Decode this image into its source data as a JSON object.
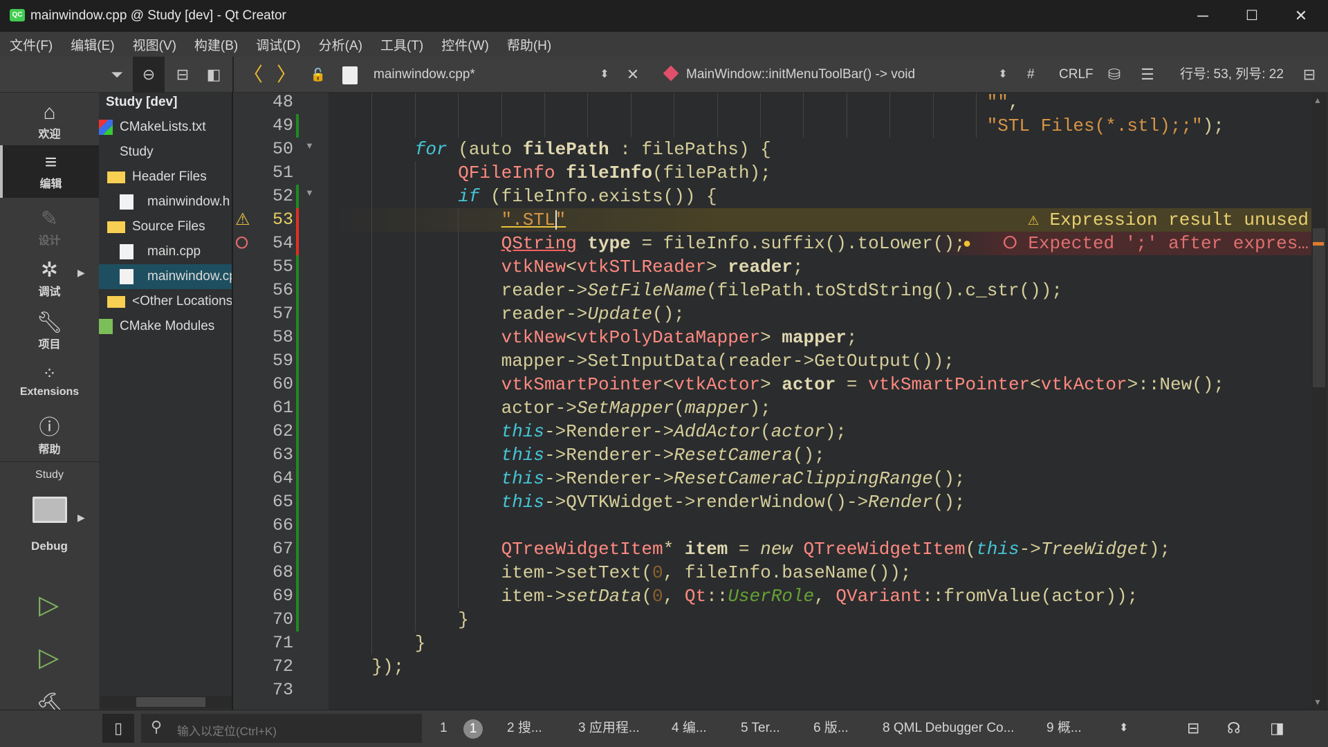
{
  "window": {
    "title": "mainwindow.cpp @ Study [dev] - Qt Creator",
    "app_icon": "QC",
    "minimize": "─",
    "maximize": "☐",
    "close": "✕"
  },
  "menu": [
    "文件(F)",
    "编辑(E)",
    "视图(V)",
    "构建(B)",
    "调试(D)",
    "分析(A)",
    "工具(T)",
    "控件(W)",
    "帮助(H)"
  ],
  "editor_toolbar": {
    "file_name": "mainwindow.cpp*",
    "function": "MainWindow::initMenuToolBar() -> void",
    "hash": "#",
    "line_ending": "CRLF",
    "position": "行号: 53, 列号: 22"
  },
  "modes": [
    {
      "label": "欢迎",
      "icon": "home-icon"
    },
    {
      "label": "编辑",
      "icon": "edit-icon",
      "selected": true
    },
    {
      "label": "设计",
      "icon": "design-icon",
      "disabled": true
    },
    {
      "label": "调试",
      "icon": "debug-icon"
    },
    {
      "label": "项目",
      "icon": "wrench-icon"
    },
    {
      "label": "Extensions",
      "icon": "extensions-icon"
    },
    {
      "label": "帮助",
      "icon": "help-icon"
    }
  ],
  "kit": {
    "project": "Study",
    "config": "Debug"
  },
  "tree": [
    {
      "label": "Study [dev]",
      "level": 0,
      "icon": "none",
      "bold": true
    },
    {
      "label": "CMakeLists.txt",
      "level": 0,
      "icon": "cmake-icon"
    },
    {
      "label": "Study",
      "level": 0,
      "icon": "hammer-icon"
    },
    {
      "label": "Header Files",
      "level": 1,
      "icon": "folder-icon"
    },
    {
      "label": "mainwindow.h",
      "level": 2,
      "icon": "header-file-icon"
    },
    {
      "label": "Source Files",
      "level": 1,
      "icon": "folder-icon"
    },
    {
      "label": "main.cpp",
      "level": 2,
      "icon": "cpp-file-icon"
    },
    {
      "label": "mainwindow.cpp",
      "level": 2,
      "icon": "cpp-file-icon",
      "selected": true
    },
    {
      "label": "<Other Locations>",
      "level": 1,
      "icon": "folder-icon"
    },
    {
      "label": "CMake Modules",
      "level": 0,
      "icon": "modules-icon"
    }
  ],
  "code": {
    "first_line": 48,
    "cursor": {
      "line": 53,
      "column": 22
    },
    "lines": [
      {
        "n": 48,
        "indent": 61,
        "tokens": [
          [
            "\"\"",
            "str"
          ],
          [
            ",",
            "p"
          ]
        ]
      },
      {
        "n": 49,
        "indent": 61,
        "tokens": [
          [
            "\"STL Files(*.stl);;\"",
            "str"
          ],
          [
            ");",
            "p"
          ]
        ]
      },
      {
        "n": 50,
        "indent": 8,
        "fold": true,
        "tokens": [
          [
            "for",
            "kw"
          ],
          [
            " (auto ",
            "p"
          ],
          [
            "filePath",
            "b"
          ],
          [
            " : filePaths) {",
            "p"
          ]
        ]
      },
      {
        "n": 51,
        "indent": 12,
        "tokens": [
          [
            "QFileInfo",
            "t"
          ],
          [
            " ",
            "p"
          ],
          [
            "fileInfo",
            "b"
          ],
          [
            "(filePath);",
            "p"
          ]
        ]
      },
      {
        "n": 52,
        "indent": 12,
        "fold": true,
        "tokens": [
          [
            "if",
            "kw"
          ],
          [
            " (fileInfo.exists()) {",
            "p"
          ]
        ]
      },
      {
        "n": 53,
        "indent": 16,
        "marker": "warning",
        "tokens": [
          [
            "\".STL\"",
            "str warnu"
          ]
        ]
      },
      {
        "n": 54,
        "indent": 16,
        "marker": "error",
        "tokens": [
          [
            "QString",
            "t erru"
          ],
          [
            " ",
            "p"
          ],
          [
            "type",
            "b"
          ],
          [
            " = fileInfo.suffix().toLower();",
            "p"
          ]
        ]
      },
      {
        "n": 55,
        "indent": 16,
        "tokens": [
          [
            "vtkNew",
            "t"
          ],
          [
            "<",
            "p"
          ],
          [
            "vtkSTLReader",
            "t"
          ],
          [
            "> ",
            "p"
          ],
          [
            "reader",
            "b"
          ],
          [
            ";",
            "p"
          ]
        ]
      },
      {
        "n": 56,
        "indent": 16,
        "tokens": [
          [
            "reader->",
            "p"
          ],
          [
            "SetFileName",
            "i"
          ],
          [
            "(filePath.toStdString().c_str());",
            "p"
          ]
        ]
      },
      {
        "n": 57,
        "indent": 16,
        "tokens": [
          [
            "reader->",
            "p"
          ],
          [
            "Update",
            "i"
          ],
          [
            "();",
            "p"
          ]
        ]
      },
      {
        "n": 58,
        "indent": 16,
        "tokens": [
          [
            "vtkNew",
            "t"
          ],
          [
            "<",
            "p"
          ],
          [
            "vtkPolyDataMapper",
            "t"
          ],
          [
            "> ",
            "p"
          ],
          [
            "mapper",
            "b"
          ],
          [
            ";",
            "p"
          ]
        ]
      },
      {
        "n": 59,
        "indent": 16,
        "tokens": [
          [
            "mapper->SetInputData(reader->GetOutput());",
            "p"
          ]
        ]
      },
      {
        "n": 60,
        "indent": 16,
        "tokens": [
          [
            "vtkSmartPointer",
            "t"
          ],
          [
            "<",
            "p"
          ],
          [
            "vtkActor",
            "t"
          ],
          [
            "> ",
            "p"
          ],
          [
            "actor",
            "b"
          ],
          [
            " = ",
            "p"
          ],
          [
            "vtkSmartPointer",
            "t"
          ],
          [
            "<",
            "p"
          ],
          [
            "vtkActor",
            "t"
          ],
          [
            ">::New();",
            "p"
          ]
        ]
      },
      {
        "n": 61,
        "indent": 16,
        "tokens": [
          [
            "actor->",
            "p"
          ],
          [
            "SetMapper",
            "i"
          ],
          [
            "(",
            "p"
          ],
          [
            "mapper",
            "i"
          ],
          [
            ");",
            "p"
          ]
        ]
      },
      {
        "n": 62,
        "indent": 16,
        "tokens": [
          [
            "this",
            "kw"
          ],
          [
            "->Renderer->",
            "p"
          ],
          [
            "AddActor",
            "i"
          ],
          [
            "(",
            "p"
          ],
          [
            "actor",
            "i"
          ],
          [
            ");",
            "p"
          ]
        ]
      },
      {
        "n": 63,
        "indent": 16,
        "tokens": [
          [
            "this",
            "kw"
          ],
          [
            "->Renderer->",
            "p"
          ],
          [
            "ResetCamera",
            "i"
          ],
          [
            "();",
            "p"
          ]
        ]
      },
      {
        "n": 64,
        "indent": 16,
        "tokens": [
          [
            "this",
            "kw"
          ],
          [
            "->Renderer->",
            "p"
          ],
          [
            "ResetCameraClippingRange",
            "i"
          ],
          [
            "();",
            "p"
          ]
        ]
      },
      {
        "n": 65,
        "indent": 16,
        "tokens": [
          [
            "this",
            "kw"
          ],
          [
            "->QVTKWidget->renderWindow()->",
            "p"
          ],
          [
            "Render",
            "i"
          ],
          [
            "();",
            "p"
          ]
        ]
      },
      {
        "n": 66,
        "indent": 16,
        "tokens": []
      },
      {
        "n": 67,
        "indent": 16,
        "tokens": [
          [
            "QTreeWidgetItem",
            "t"
          ],
          [
            "* ",
            "p"
          ],
          [
            "item",
            "b"
          ],
          [
            " = ",
            "p"
          ],
          [
            "new",
            "i"
          ],
          [
            " ",
            "p"
          ],
          [
            "QTreeWidgetItem",
            "t"
          ],
          [
            "(",
            "p"
          ],
          [
            "this",
            "kw"
          ],
          [
            "->",
            "p"
          ],
          [
            "TreeWidget",
            "i"
          ],
          [
            ");",
            "p"
          ]
        ]
      },
      {
        "n": 68,
        "indent": 16,
        "tokens": [
          [
            "item->setText(",
            "p"
          ],
          [
            "0",
            "num"
          ],
          [
            ", fileInfo.baseName());",
            "p"
          ]
        ]
      },
      {
        "n": 69,
        "indent": 16,
        "tokens": [
          [
            "item->",
            "p"
          ],
          [
            "setData",
            "i"
          ],
          [
            "(",
            "p"
          ],
          [
            "0",
            "num"
          ],
          [
            ", ",
            "p"
          ],
          [
            "Qt",
            "t"
          ],
          [
            "::",
            "p"
          ],
          [
            "UserRole",
            "en"
          ],
          [
            ", ",
            "p"
          ],
          [
            "QVariant",
            "t"
          ],
          [
            "::fromValue(actor));",
            "p"
          ]
        ]
      },
      {
        "n": 70,
        "indent": 12,
        "tokens": [
          [
            "}",
            "p"
          ]
        ]
      },
      {
        "n": 71,
        "indent": 8,
        "tokens": [
          [
            "}",
            "p"
          ]
        ]
      },
      {
        "n": 72,
        "indent": 4,
        "tokens": [
          [
            "});",
            "p"
          ]
        ]
      },
      {
        "n": 73,
        "indent": 0,
        "tokens": []
      }
    ],
    "diagnostics": [
      {
        "line": 53,
        "type": "warning",
        "text": "Expression result unused"
      },
      {
        "line": 54,
        "type": "error",
        "text": "Expected ';' after expres…"
      }
    ]
  },
  "bottom": {
    "locator_placeholder": "输入以定位(Ctrl+K)",
    "tabs": [
      "1",
      "2 搜...",
      "3 应用程...",
      "4 编...",
      "5 Ter...",
      "6 版...",
      "8 QML Debugger Co...",
      "9 概..."
    ],
    "issues_badge": "1"
  },
  "colors": {
    "accent_selection": "#1e4f60",
    "warning": "#e8c440",
    "error": "#e06c6c",
    "change_added": "#1f8a1f",
    "change_modified": "#e03020"
  }
}
